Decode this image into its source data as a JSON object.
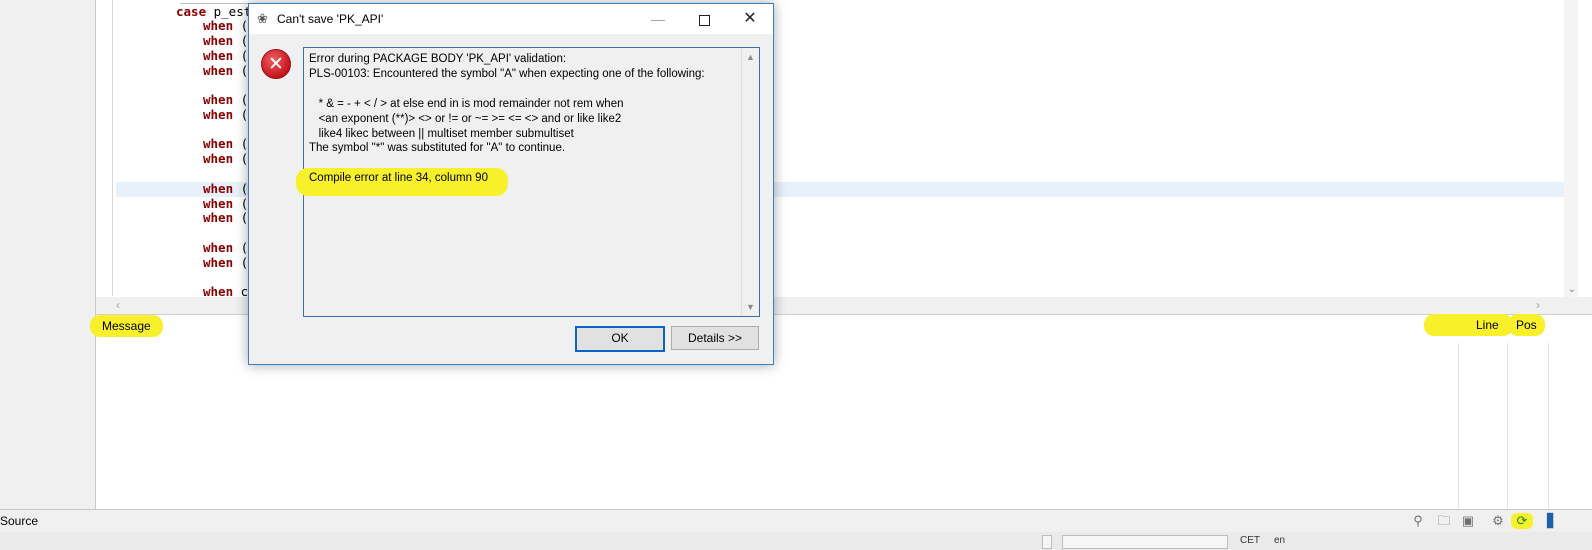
{
  "dialog": {
    "title": "Can't save 'PK_API'",
    "ok_label": "OK",
    "details_label": "Details >>",
    "message_lines": [
      "Error during PACKAGE BODY 'PK_API' validation:",
      "PLS-00103: Encountered the symbol \"A\" when expecting one of the following:",
      "",
      "   * & = - + < / > at else end in is mod remainder not rem when",
      "   <an exponent (**)> <> or != or ~= >= <= <> and or like like2",
      "   like4 likec between || multiset member submultiset",
      "The symbol \"*\" was substituted for \"A\" to continue.",
      "",
      "Compile error at line 34, column 90"
    ]
  },
  "editor": {
    "lines": [
      {
        "indent": "case",
        "kw": "case",
        "rest": " p_est"
      },
      {
        "indent": "when",
        "kw": "when",
        "rest": " ("
      },
      {
        "indent": "when",
        "kw": "when",
        "rest": " ("
      },
      {
        "indent": "when",
        "kw": "when",
        "rest": " ("
      },
      {
        "indent": "when",
        "kw": "when",
        "rest": " ("
      },
      {
        "indent": "when",
        "kw": "when",
        "rest": " ("
      },
      {
        "indent": "when",
        "kw": "when",
        "rest": " ("
      },
      {
        "indent": "when",
        "kw": "when",
        "rest": " ("
      },
      {
        "indent": "when",
        "kw": "when",
        "rest": " ("
      },
      {
        "indent": "when",
        "kw": "when",
        "rest": " ("
      },
      {
        "indent": "when",
        "kw": "when",
        "rest": " ("
      },
      {
        "indent": "when",
        "kw": "when",
        "rest": " ("
      },
      {
        "indent": "when",
        "kw": "when",
        "rest": " ("
      },
      {
        "indent": "when",
        "kw": "when",
        "rest": " ("
      },
      {
        "indent": "when",
        "kw": "when",
        "rest": " c"
      }
    ]
  },
  "messages_panel": {
    "col_message": "Message",
    "col_line": "Line",
    "col_pos": "Pos"
  },
  "bottom_bar": {
    "source_label": "Source",
    "status_cet": "CET",
    "status_lang": "en"
  },
  "colors": {
    "highlight": "#f7f02a",
    "keyword": "#8b0000",
    "error_red": "#c4141c",
    "focus_blue": "#0a64c8"
  }
}
